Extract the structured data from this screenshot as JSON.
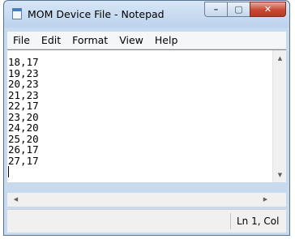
{
  "window": {
    "title": "MOM Device File - Notepad",
    "icon": "notepad-icon",
    "controls": {
      "minimize": "minimize-icon",
      "maximize": "maximize-icon",
      "close": "close-icon"
    }
  },
  "menu": [
    "File",
    "Edit",
    "Format",
    "View",
    "Help"
  ],
  "editor": {
    "lines": [
      "18,17",
      "19,23",
      "20,23",
      "21,23",
      "22,17",
      "23,20",
      "24,20",
      "25,20",
      "26,17",
      "27,17"
    ]
  },
  "status": {
    "position": "Ln 1, Col"
  },
  "colors": {
    "titlebar": "#c7daee",
    "close_button": "#c74734"
  }
}
